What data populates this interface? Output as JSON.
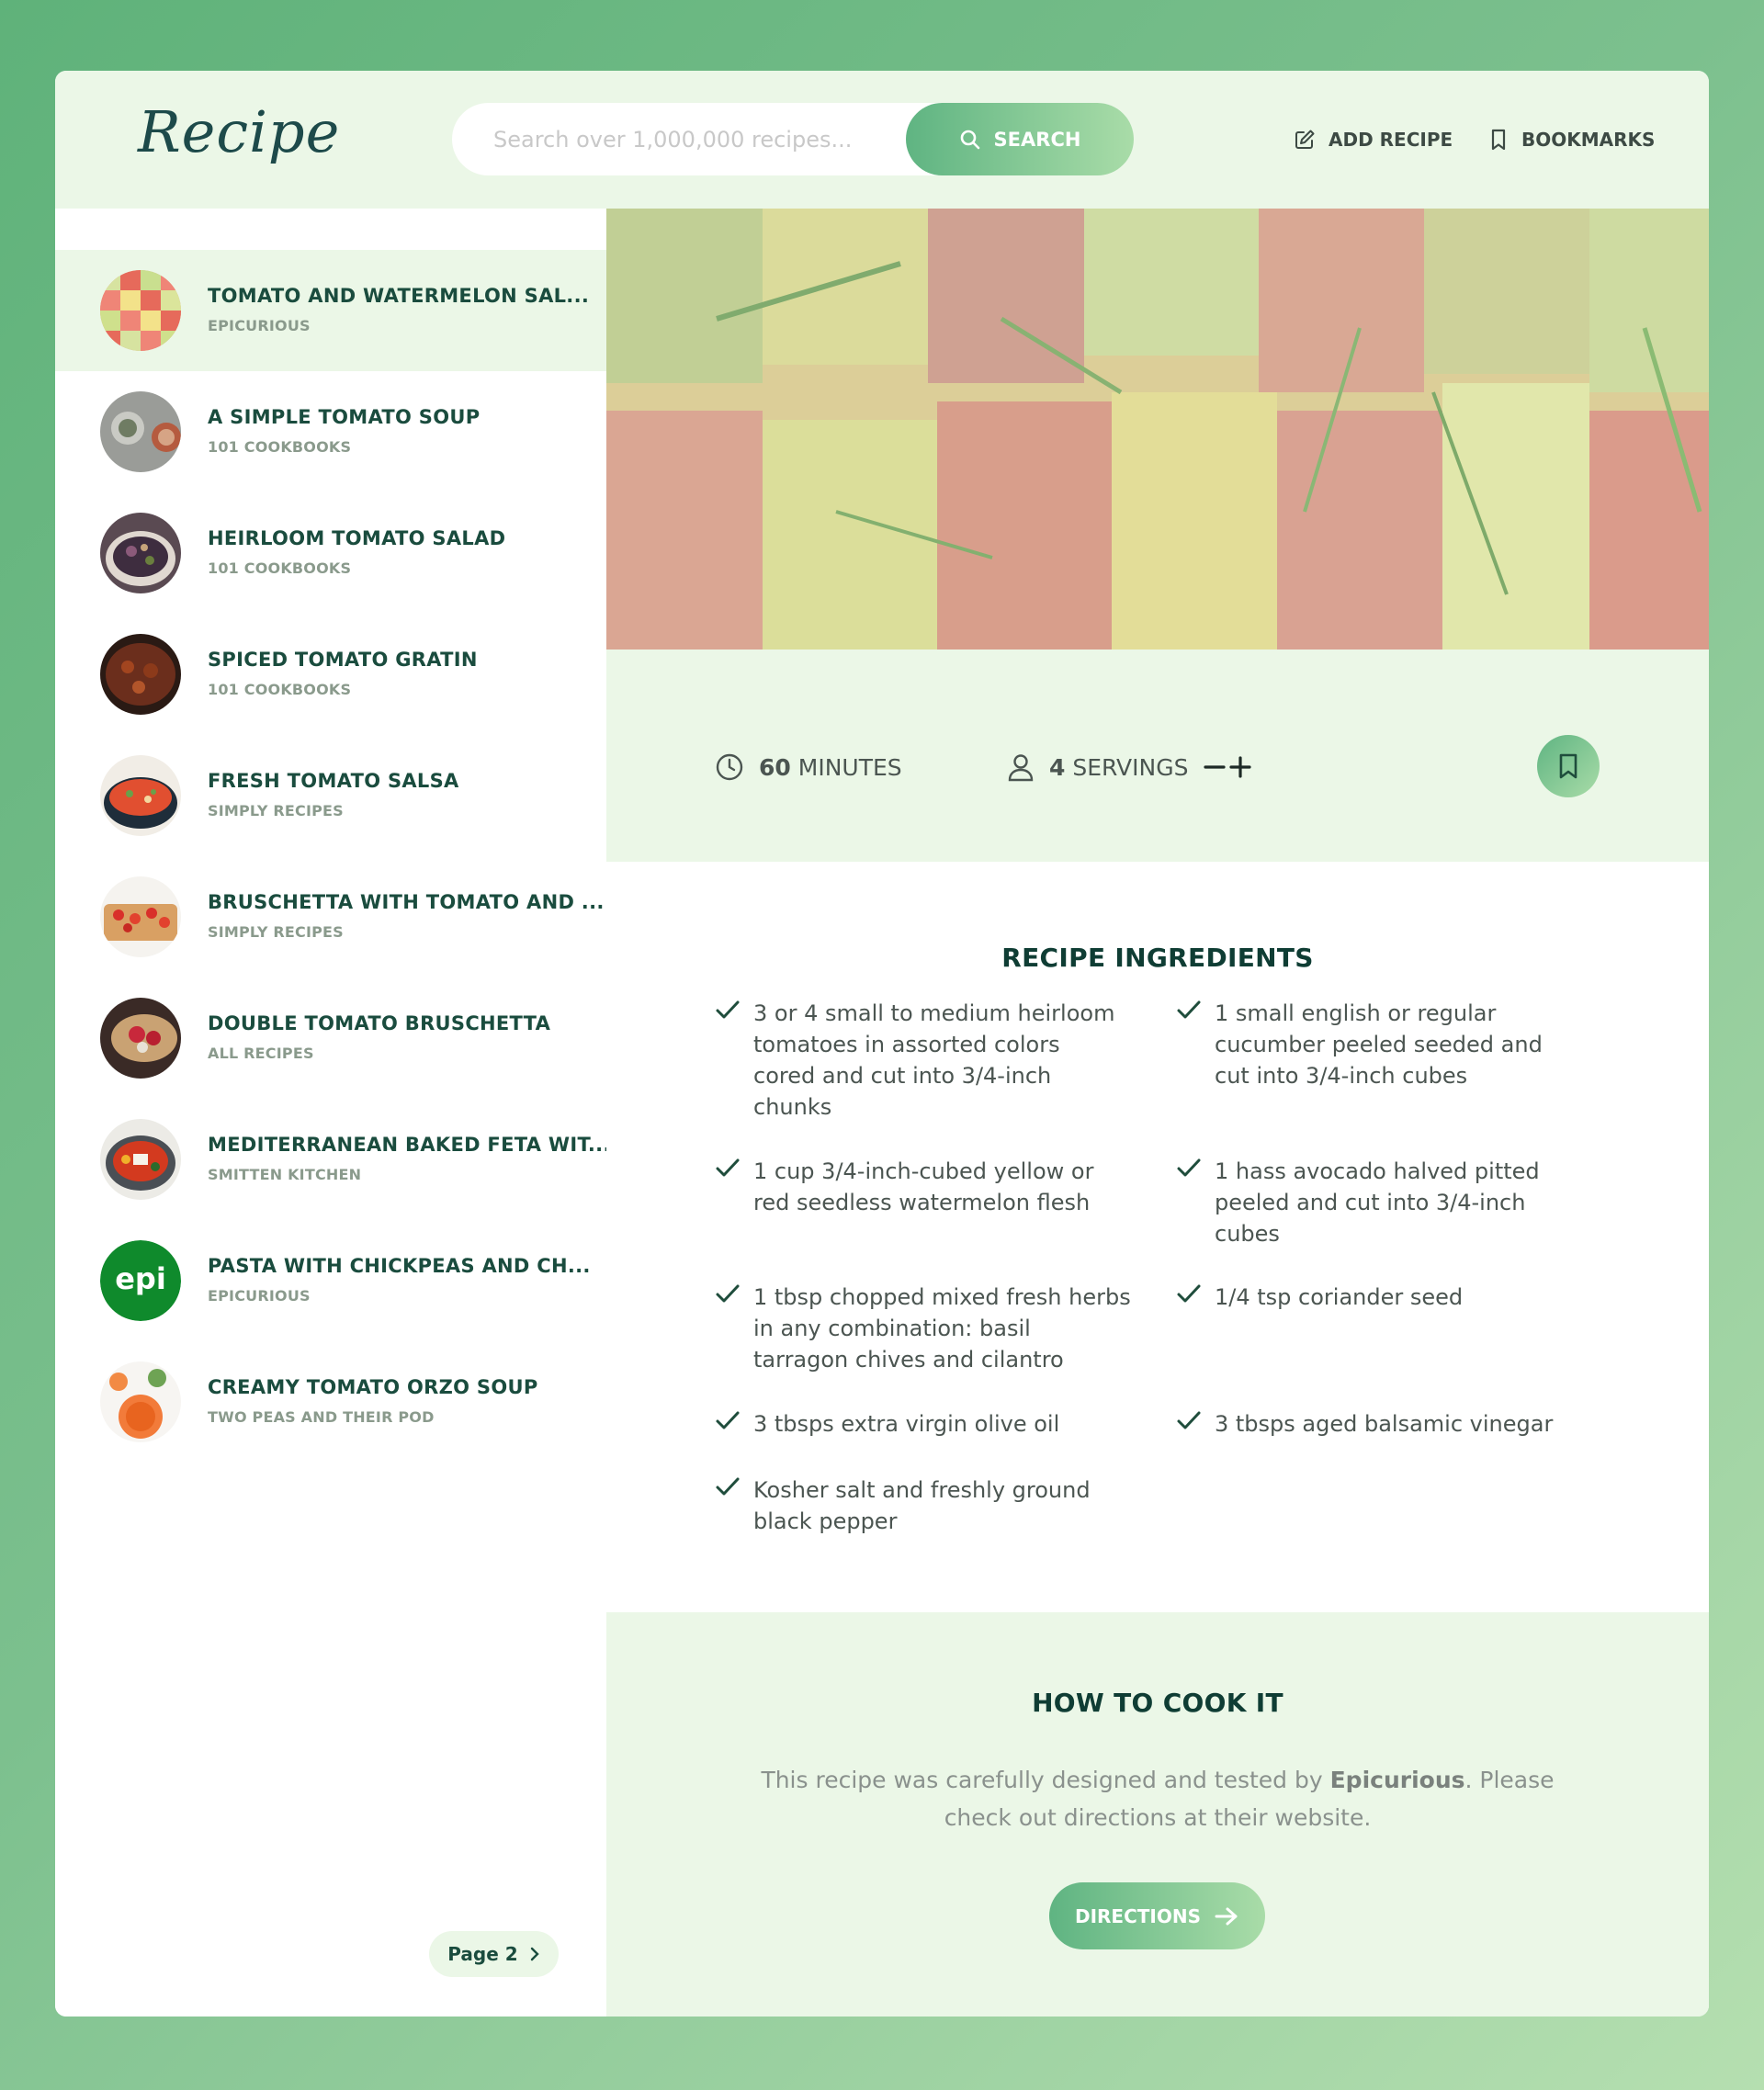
{
  "header": {
    "logo": "Recipe",
    "search_placeholder": "Search over 1,000,000 recipes...",
    "search_button": "SEARCH",
    "add_recipe": "ADD RECIPE",
    "bookmarks": "BOOKMARKS"
  },
  "results": [
    {
      "title": "TOMATO AND WATERMELON SAL...",
      "publisher": "EPICURIOUS",
      "active": true
    },
    {
      "title": "A SIMPLE TOMATO SOUP",
      "publisher": "101 COOKBOOKS"
    },
    {
      "title": "HEIRLOOM TOMATO SALAD",
      "publisher": "101 COOKBOOKS"
    },
    {
      "title": "SPICED TOMATO GRATIN",
      "publisher": "101 COOKBOOKS"
    },
    {
      "title": "FRESH TOMATO SALSA",
      "publisher": "SIMPLY RECIPES"
    },
    {
      "title": "BRUSCHETTA WITH TOMATO AND ...",
      "publisher": "SIMPLY RECIPES"
    },
    {
      "title": "DOUBLE TOMATO BRUSCHETTA",
      "publisher": "ALL RECIPES"
    },
    {
      "title": "MEDITERRANEAN BAKED FETA WIT...",
      "publisher": "SMITTEN KITCHEN"
    },
    {
      "title": "PASTA WITH CHICKPEAS AND CH...",
      "publisher": "EPICURIOUS",
      "thumb_text": "epi"
    },
    {
      "title": "CREAMY TOMATO ORZO SOUP",
      "publisher": "TWO PEAS AND THEIR POD"
    }
  ],
  "pagination": {
    "next_label": "Page 2"
  },
  "recipe": {
    "cook_time": "60",
    "cook_time_unit": "MINUTES",
    "servings": "4",
    "servings_unit": "SERVINGS",
    "ingredients_title": "RECIPE INGREDIENTS",
    "ingredients": [
      "3 or 4 small to medium heirloom\n tomatoes in assorted colors\n cored and cut into 3/4-inch\n chunks",
      "1 small english or regular\n cucumber peeled seeded and\n cut into 3/4-inch cubes",
      "1 cup 3/4-inch-cubed yellow or\n red seedless watermelon flesh",
      "1 hass avocado halved pitted\n peeled and cut into 3/4-inch\n cubes",
      "1 tbsp chopped mixed fresh herbs\n in any combination: basil\n tarragon chives and cilantro",
      "1/4 tsp coriander seed",
      "3 tbsps extra virgin olive oil",
      "3 tbsps aged balsamic vinegar",
      " Kosher salt and freshly ground\n black pepper"
    ],
    "howto_title": "HOW TO COOK IT",
    "howto_pre": "This recipe was carefully designed and tested by ",
    "howto_publisher": "Epicurious",
    "howto_post": ". Please check out directions at their website.",
    "directions_button": "DIRECTIONS"
  },
  "colors": {
    "accent_start": "#5fb482",
    "accent_end": "#a9dca8",
    "panel_bg": "#ebf7e7",
    "dark_text": "#1a4c3e"
  }
}
